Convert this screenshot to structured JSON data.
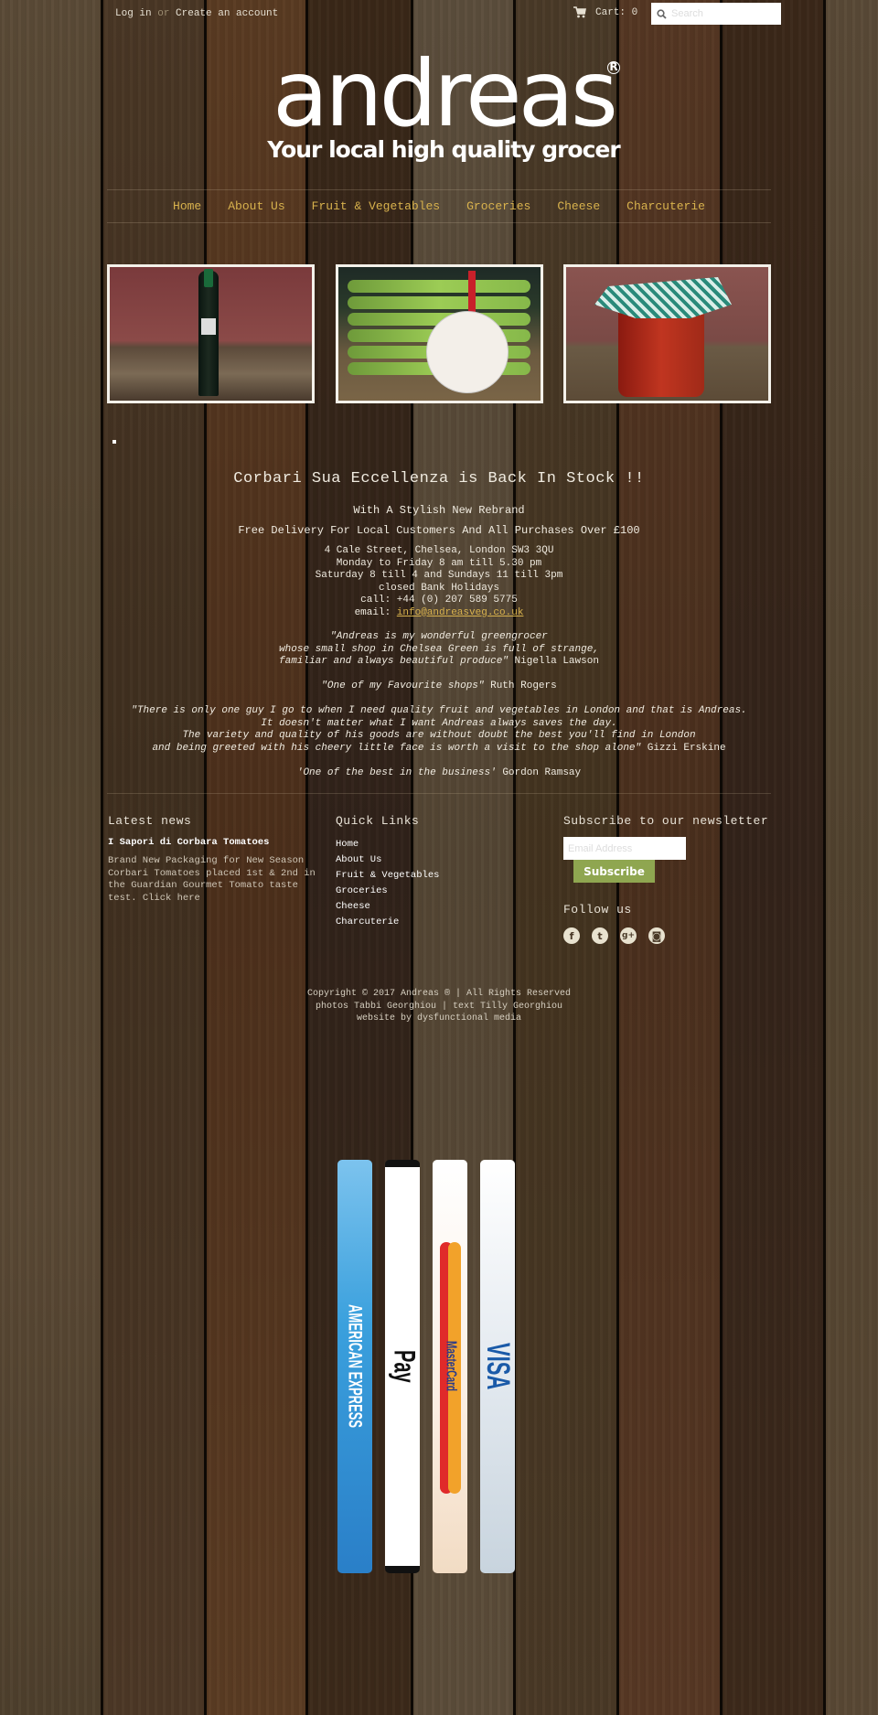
{
  "topbar": {
    "login": "Log in",
    "or": "or",
    "create_account": "Create an account",
    "cart_label": "Cart: 0",
    "search_placeholder": "Search"
  },
  "logo": {
    "name": "andreas",
    "registered": "R",
    "tagline": "Your local high quality grocer"
  },
  "nav": [
    {
      "label": "Home"
    },
    {
      "label": "About Us"
    },
    {
      "label": "Fruit & Vegetables"
    },
    {
      "label": "Groceries"
    },
    {
      "label": "Cheese"
    },
    {
      "label": "Charcuterie"
    }
  ],
  "banners": [
    {
      "subject": "olive oil bottle"
    },
    {
      "subject": "Asperges de Pertuis asparagus"
    },
    {
      "subject": "I Sapori di Corbara tomato jar"
    }
  ],
  "main": {
    "headline": "Corbari Sua Eccellenza is Back In Stock !!",
    "subheading": "With A Stylish New Rebrand",
    "delivery": "Free Delivery For Local Customers And All Purchases Over £100",
    "address": "4 Cale Street, Chelsea, London SW3 3QU",
    "hours_weekday": "Monday to Friday 8 am till 5.30 pm",
    "hours_weekend": "Saturday 8 till 4 and Sundays 11 till 3pm",
    "holidays": "closed Bank Holidays",
    "phone": "call: +44 (0) 207 589 5775",
    "email_label": "email:",
    "email": "info@andreasveg.co.uk"
  },
  "quotes": [
    {
      "lines": [
        "\"Andreas is my wonderful greengrocer",
        "whose small shop in Chelsea Green is full of strange,",
        "familiar and always beautiful produce\""
      ],
      "author": "Nigella Lawson"
    },
    {
      "lines": [
        "\"One of my Favourite shops\""
      ],
      "author": "Ruth Rogers"
    },
    {
      "lines": [
        "\"There is only one guy I go to when I need quality fruit and vegetables in London and that is Andreas.",
        "It doesn't matter what I want Andreas always saves the day.",
        "The variety and quality of his goods are without doubt the best you'll find in London",
        "and being greeted with his cheery little face is worth a visit to the shop alone\""
      ],
      "author": "Gizzi Erskine"
    },
    {
      "lines": [
        "'One of the best in the business'"
      ],
      "author": "Gordon Ramsay"
    }
  ],
  "footer": {
    "latest_news": {
      "heading": "Latest news",
      "title": "I Sapori di Corbara Tomatoes",
      "body": "Brand New Packaging for New Season Corbari Tomatoes placed 1st & 2nd in the Guardian Gourmet Tomato taste test.",
      "link": "Click here"
    },
    "quick_links": {
      "heading": "Quick Links",
      "items": [
        "Home",
        "About Us",
        "Fruit & Vegetables",
        "Groceries",
        "Cheese",
        "Charcuterie"
      ]
    },
    "newsletter": {
      "heading": "Subscribe to our newsletter",
      "email_placeholder": "Email Address",
      "button": "Subscribe",
      "follow": "Follow us",
      "socials": [
        {
          "name": "facebook",
          "glyph": "f"
        },
        {
          "name": "twitter",
          "glyph": "t"
        },
        {
          "name": "google-plus",
          "glyph": "g+"
        },
        {
          "name": "instagram",
          "glyph": "◙"
        }
      ]
    },
    "copyright": "Copyright © 2017 Andreas ® | All Rights Reserved",
    "credits": "photos Tabbi Georghiou | text Tilly Georghiou",
    "website_by": "website by dysfunctional media"
  },
  "payments": [
    {
      "name": "American Express",
      "text": "AMERICAN EXPRESS"
    },
    {
      "name": "Apple Pay",
      "text": "Pay"
    },
    {
      "name": "MasterCard",
      "text": "MasterCard"
    },
    {
      "name": "Visa",
      "text": "VISA"
    }
  ],
  "colors": {
    "link_gold": "#d8b24d",
    "subscribe_green": "#8fa650"
  }
}
